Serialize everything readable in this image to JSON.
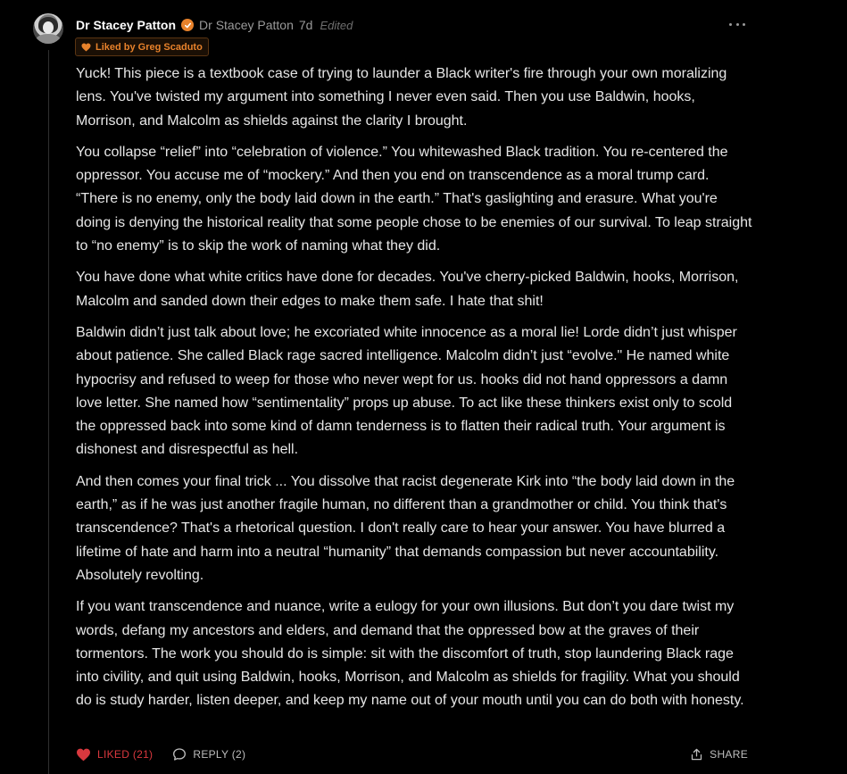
{
  "comment": {
    "author": "Dr Stacey Patton",
    "handle": "Dr Stacey Patton",
    "time": "7d",
    "edited": "Edited",
    "liked_by": "Liked by Greg Scaduto",
    "paragraphs": [
      "Yuck! This piece is a textbook case of trying to launder a Black writer's fire through your own moralizing lens. You've twisted my argument into something I never even said. Then you use Baldwin, hooks, Morrison, and Malcolm as shields against the clarity I brought.",
      "You collapse “relief” into “celebration of violence.” You whitewashed Black tradition. You re-centered the oppressor. You accuse me of “mockery.” And then you end on transcendence as a moral trump card. “There is no enemy, only the body laid down in the earth.” That's gaslighting and erasure. What you're doing is denying the historical reality that some people chose to be enemies of our survival. To leap straight to “no enemy” is to skip the work of naming what they did.",
      "You have done what white critics have done for decades. You've cherry-picked Baldwin, hooks, Morrison, Malcolm and sanded down their edges to make them safe. I hate that shit!",
      "Baldwin didn’t just talk about love; he excoriated white innocence as a moral lie! Lorde didn’t just whisper about patience. She called Black rage sacred intelligence. Malcolm didn’t just “evolve.\" He named white hypocrisy and refused to weep for those who never wept for us. hooks did not hand oppressors a damn love letter. She named how “sentimentality” props up abuse. To act like these thinkers exist only to scold the oppressed back into some kind of damn tenderness is to flatten their radical truth. Your argument is dishonest and disrespectful as hell.",
      "And then comes your final trick ... You dissolve that racist degenerate Kirk into “the body laid down in the earth,” as if he was just another fragile human, no different than a grandmother or child. You think that's transcendence? That's a rhetorical question. I don't really care to hear your answer. You have blurred a lifetime of hate and harm into a neutral “humanity” that demands compassion but never accountability. Absolutely revolting.",
      "If you want transcendence and nuance, write a eulogy for your own illusions. But don’t you dare twist my words, defang my ancestors and elders, and demand that the oppressed bow at the graves of their tormentors. The work you should do is simple: sit with the discomfort of truth, stop laundering Black rage into civility, and quit using Baldwin, hooks, Morrison, and Malcolm as shields for fragility. What you should do is study harder, listen deeper, and keep my name out of your mouth until you can do both with honesty."
    ],
    "actions": {
      "like_label": "LIKED (21)",
      "reply_label": "REPLY (2)",
      "share_label": "SHARE"
    }
  },
  "icons": {
    "verified": "verified-check-icon",
    "heart": "heart-icon",
    "reply": "speech-bubble-icon",
    "share": "share-icon",
    "more": "more-dots-icon"
  },
  "colors": {
    "background": "#000000",
    "accent_orange": "#e8822b",
    "liked_red": "#d9383e",
    "text": "#e6e6e6",
    "muted": "#9a9a9a"
  }
}
